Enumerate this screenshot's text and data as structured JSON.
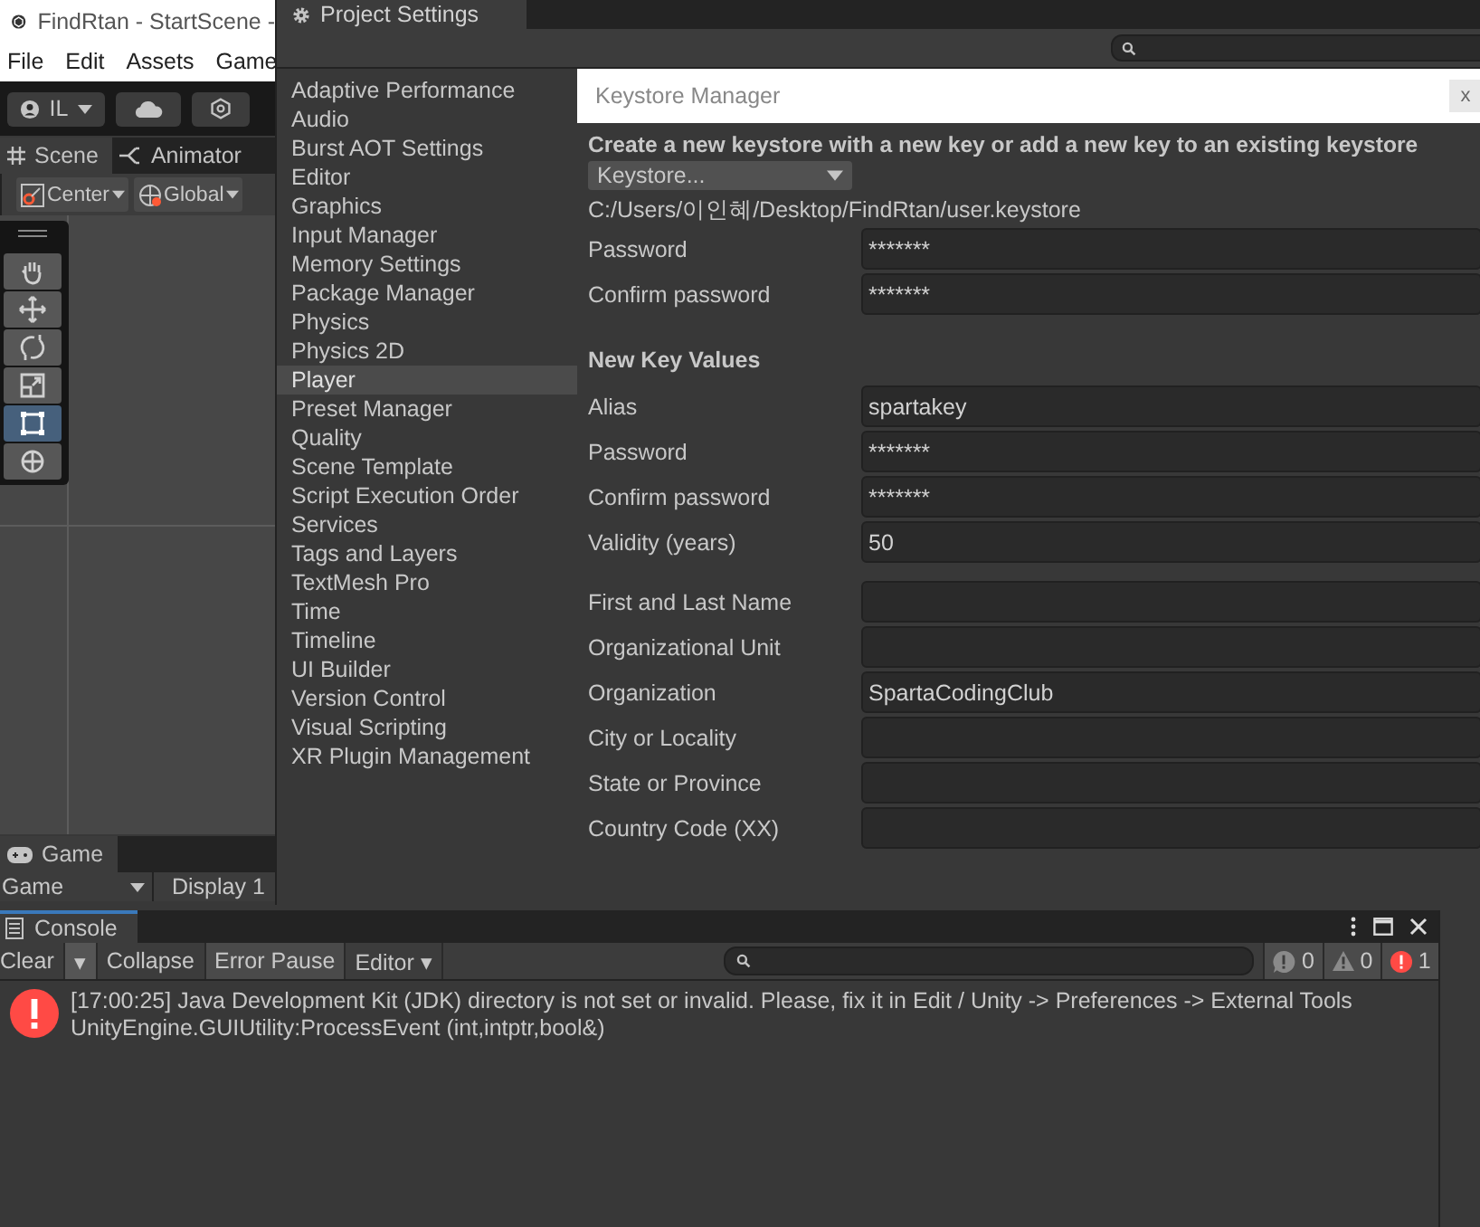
{
  "editor": {
    "title": "FindRtan - StartScene -",
    "menu": [
      "File",
      "Edit",
      "Assets",
      "Game"
    ],
    "account": "IL",
    "scene_tabs": [
      {
        "label": "Scene",
        "kind": "scene",
        "selected": true
      },
      {
        "label": "Animator",
        "kind": "animator",
        "selected": false
      }
    ],
    "scene_toolbar": [
      {
        "label": "Center",
        "kind": "pivot"
      },
      {
        "label": "Global",
        "kind": "global"
      }
    ],
    "tools": [
      {
        "kind": "hand",
        "selected": false
      },
      {
        "kind": "move",
        "selected": false
      },
      {
        "kind": "rotate",
        "selected": false
      },
      {
        "kind": "scale",
        "selected": false
      },
      {
        "kind": "rect",
        "selected": true
      },
      {
        "kind": "transform",
        "selected": false
      }
    ],
    "game_tab": "Game",
    "game_toolbar": [
      "Game",
      "Display 1"
    ]
  },
  "project_settings": {
    "title": "Project Settings",
    "sidebar": [
      {
        "label": "Adaptive Performance",
        "selected": false
      },
      {
        "label": "Audio",
        "selected": false
      },
      {
        "label": "Burst AOT Settings",
        "selected": false
      },
      {
        "label": "Editor",
        "selected": false
      },
      {
        "label": "Graphics",
        "selected": false
      },
      {
        "label": "Input Manager",
        "selected": false
      },
      {
        "label": "Memory Settings",
        "selected": false
      },
      {
        "label": "Package Manager",
        "selected": false
      },
      {
        "label": "Physics",
        "selected": false
      },
      {
        "label": "Physics 2D",
        "selected": false
      },
      {
        "label": "Player",
        "selected": true
      },
      {
        "label": "Preset Manager",
        "selected": false
      },
      {
        "label": "Quality",
        "selected": false
      },
      {
        "label": "Scene Template",
        "selected": false
      },
      {
        "label": "Script Execution Order",
        "selected": false
      },
      {
        "label": "Services",
        "selected": false
      },
      {
        "label": "Tags and Layers",
        "selected": false
      },
      {
        "label": "TextMesh Pro",
        "selected": false
      },
      {
        "label": "Time",
        "selected": false
      },
      {
        "label": "Timeline",
        "selected": false
      },
      {
        "label": "UI Builder",
        "selected": false
      },
      {
        "label": "Version Control",
        "selected": false
      },
      {
        "label": "Visual Scripting",
        "selected": false
      },
      {
        "label": "XR Plugin Management",
        "selected": false
      }
    ]
  },
  "keystore_manager": {
    "title": "Keystore Manager",
    "close": "x",
    "heading": "Create a new keystore with a new key or add a new key to an existing keystore",
    "dropdown": "Keystore...",
    "path": "C:/Users/이인혜/Desktop/FindRtan/user.keystore",
    "keystore_fields": [
      {
        "label": "Password",
        "value": "*******"
      },
      {
        "label": "Confirm password",
        "value": "*******"
      }
    ],
    "section": "New Key Values",
    "key_fields": [
      {
        "label": "Alias",
        "value": "spartakey"
      },
      {
        "label": "Password",
        "value": "*******"
      },
      {
        "label": "Confirm password",
        "value": "*******"
      },
      {
        "label": "Validity (years)",
        "value": "50"
      }
    ],
    "owner_fields": [
      {
        "label": "First and Last Name"
      },
      {
        "label": "Organizational Unit"
      },
      {
        "label": "Organization",
        "value": "SpartaCodingClub"
      },
      {
        "label": "City or Locality"
      },
      {
        "label": "State or Province"
      },
      {
        "label": "Country Code (XX)"
      }
    ]
  },
  "console": {
    "title": "Console",
    "buttons": [
      {
        "label": "Clear",
        "kind": "button"
      },
      {
        "label": "▾",
        "kind": "caret"
      },
      {
        "label": "Collapse",
        "kind": "toggle",
        "on": false
      },
      {
        "label": "Error Pause",
        "kind": "toggle",
        "on": true
      },
      {
        "label": "Editor ▾",
        "kind": "button"
      }
    ],
    "counters": [
      {
        "kind": "info",
        "count": "0"
      },
      {
        "kind": "warning",
        "count": "0"
      },
      {
        "kind": "error",
        "count": "1"
      }
    ],
    "messages": [
      {
        "kind": "error",
        "lines": [
          "[17:00:25] Java Development Kit (JDK) directory is not set or invalid. Please, fix it in Edit / Unity -> Preferences -> External Tools",
          "UnityEngine.GUIUtility:ProcessEvent (int,intptr,bool&)"
        ]
      }
    ]
  }
}
